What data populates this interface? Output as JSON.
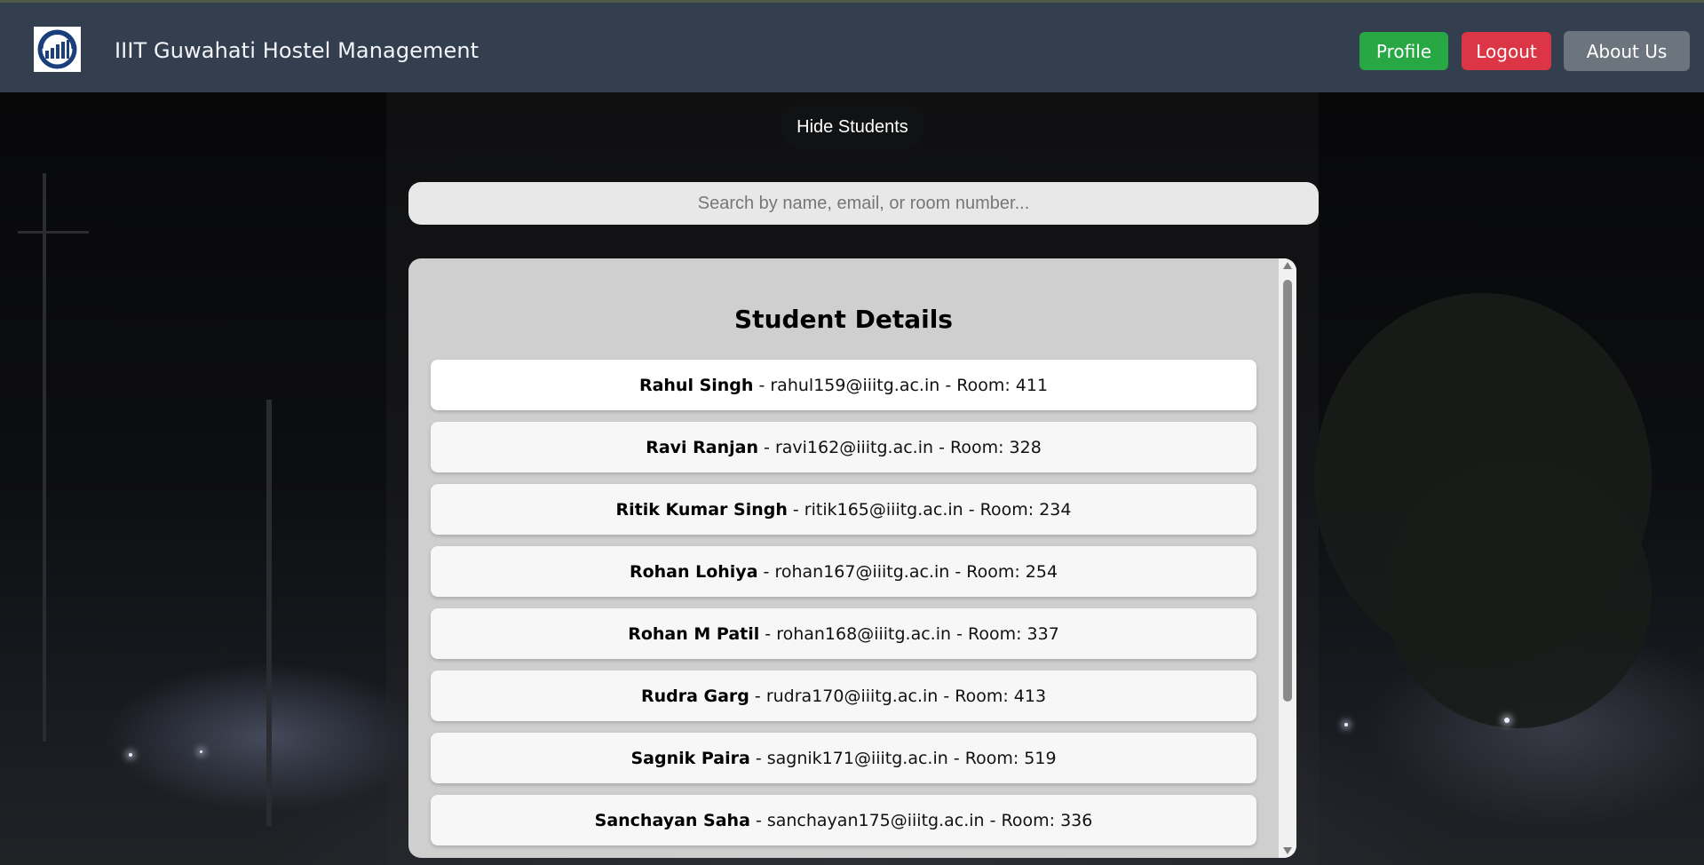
{
  "navbar": {
    "brand": "IIIT Guwahati Hostel Management",
    "buttons": {
      "profile": "Profile",
      "logout": "Logout",
      "about": "About Us"
    },
    "colors": {
      "background": "#333e4f",
      "profile": "#28a745",
      "logout": "#dc3545",
      "about": "#6c757d"
    }
  },
  "toggle": {
    "label": "Hide Students"
  },
  "search": {
    "placeholder": "Search by name, email, or room number...",
    "value": ""
  },
  "panel": {
    "title": "Student Details",
    "students": [
      {
        "name": "Rahul Singh",
        "email": "rahul159@iiitg.ac.in",
        "room": "411"
      },
      {
        "name": "Ravi Ranjan",
        "email": "ravi162@iiitg.ac.in",
        "room": "328"
      },
      {
        "name": "Ritik Kumar Singh",
        "email": "ritik165@iiitg.ac.in",
        "room": "234"
      },
      {
        "name": "Rohan Lohiya",
        "email": "rohan167@iiitg.ac.in",
        "room": "254"
      },
      {
        "name": "Rohan M Patil",
        "email": "rohan168@iiitg.ac.in",
        "room": "337"
      },
      {
        "name": "Rudra Garg",
        "email": "rudra170@iiitg.ac.in",
        "room": "413"
      },
      {
        "name": "Sagnik Paira",
        "email": "sagnik171@iiitg.ac.in",
        "room": "519"
      },
      {
        "name": "Sanchayan Saha",
        "email": "sanchayan175@iiitg.ac.in",
        "room": "336"
      }
    ],
    "separator": " - ",
    "room_prefix": "Room: "
  }
}
